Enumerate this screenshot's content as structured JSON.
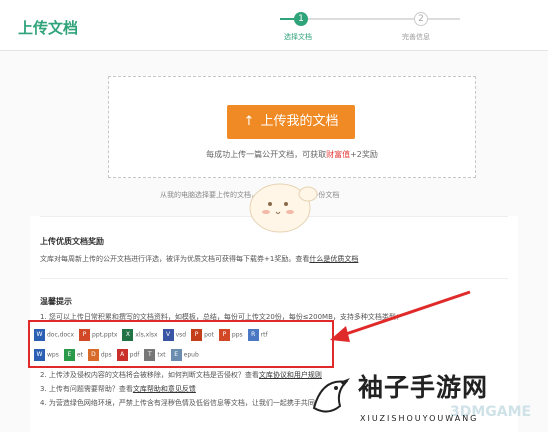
{
  "header": {
    "title": "上传文档",
    "steps": [
      {
        "number": "1",
        "label": "选择文档",
        "active": true
      },
      {
        "number": "2",
        "label": "完善信息",
        "active": false
      }
    ]
  },
  "upload": {
    "button_label": "上传我的文档",
    "hint_prefix": "每成功上传一篇公开文档，可获取",
    "hint_highlight": "财富值",
    "hint_suffix": "+2奖励",
    "sub_hint": "从我的电脑选择要上传的文档，按住ctrl可以上传多份文档"
  },
  "reward": {
    "title": "上传优质文档奖励",
    "text": "文库对每周新上传的公开文档进行评选，被评为优质文档可获得每下载券+1奖励。查看",
    "link": "什么是优质文档"
  },
  "tips": {
    "title": "温馨提示",
    "item1": "1. 您可以上传日常积累和撰写的文档资料，如模板，总结，每份可上传文20份，每份≤200MB，支持多种文档类型：",
    "filetypes_row1": [
      {
        "icon": "word-icon",
        "label": "doc,docx",
        "color": "#2b5fb4",
        "glyph": "W"
      },
      {
        "icon": "powerpoint-icon",
        "label": "ppt,pptx",
        "color": "#d24726",
        "glyph": "P"
      },
      {
        "icon": "excel-icon",
        "label": "xls,xlsx",
        "color": "#217346",
        "glyph": "X"
      },
      {
        "icon": "vsd-icon",
        "label": "vsd",
        "color": "#3955a3",
        "glyph": "V"
      },
      {
        "icon": "pot-icon",
        "label": "pot",
        "color": "#c43e1c",
        "glyph": "P"
      },
      {
        "icon": "pps-icon",
        "label": "pps",
        "color": "#d24726",
        "glyph": "P"
      },
      {
        "icon": "rtf-icon",
        "label": "rtf",
        "color": "#4a78c2",
        "glyph": "R"
      }
    ],
    "filetypes_row2": [
      {
        "icon": "wps-icon",
        "label": "wps",
        "color": "#2b5fb4",
        "glyph": "W"
      },
      {
        "icon": "et-icon",
        "label": "et",
        "color": "#2c9a4b",
        "glyph": "E"
      },
      {
        "icon": "dps-icon",
        "label": "dps",
        "color": "#d86a2a",
        "glyph": "D"
      },
      {
        "icon": "pdf-icon",
        "label": "pdf",
        "color": "#c9302c",
        "glyph": "A"
      },
      {
        "icon": "txt-icon",
        "label": "txt",
        "color": "#777777",
        "glyph": "T"
      },
      {
        "icon": "epub-icon",
        "label": "epub",
        "color": "#6a8caf",
        "glyph": "E"
      }
    ],
    "item2_prefix": "2. 上传涉及侵权内容的文档将会被移除，如何判断文档是否侵权？查看",
    "item2_link": "文库协议和用户规则",
    "item3_prefix": "3. 上传有问题需要帮助？查看",
    "item3_link": "文库帮助和意见反馈",
    "item4": "4. 为营造绿色网络环境，严禁上传含有淫秽色情及低俗信息等文档，让我们一起携手共同打造"
  },
  "watermark": {
    "main": "袖子手游网",
    "sub": "XIUZISHOUYOUWANG",
    "brand": "3DMGAME"
  },
  "colors": {
    "brand_green": "#2fa37a",
    "upload_orange": "#f08a24",
    "annotation_red": "#e02a2a"
  }
}
